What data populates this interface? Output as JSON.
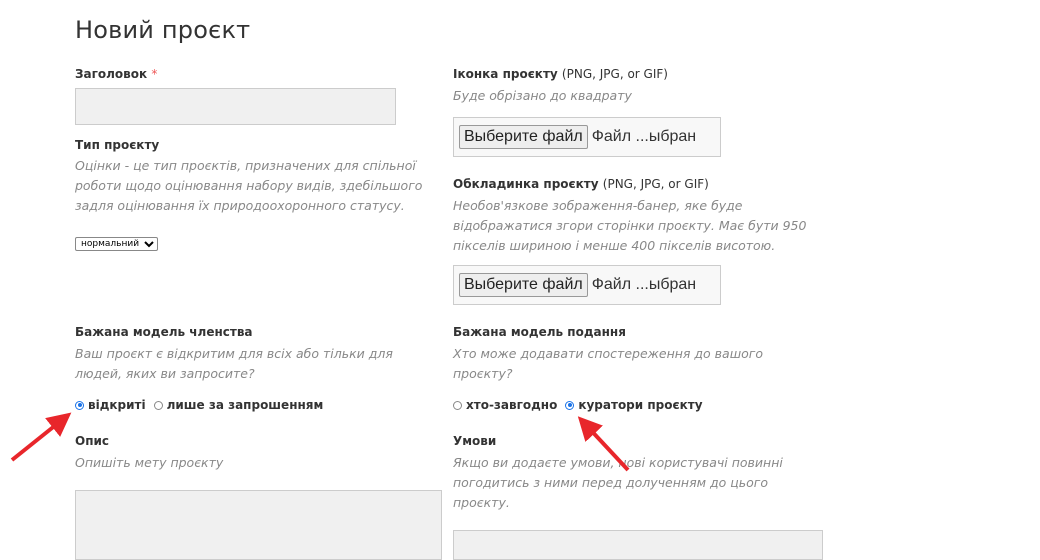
{
  "page": {
    "title": "Новий проєкт"
  },
  "left": {
    "title_label": "Заголовок",
    "required_mark": "*",
    "type_label": "Тип проєкту",
    "type_hint": [
      "Оцінки - це тип проєктів, призначених для спільної",
      "роботи щодо оцінювання набору видів, здебільшого",
      "задля оцінювання їх природоохоронного статусу."
    ],
    "type_select": "нормальний",
    "membership_label": "Бажана модель членства",
    "membership_hint": [
      "Ваш проєкт є відкритим для всіх або тільки для",
      "людей, яких ви запросите?"
    ],
    "membership_options": [
      "відкриті",
      "лише за запрошенням"
    ],
    "desc_label": "Опис",
    "desc_hint": "Опишіть мету проєкту"
  },
  "right": {
    "icon_label": "Іконка проєкту",
    "icon_formats": "(PNG, JPG, or GIF)",
    "icon_hint": "Буде обрізано до квадрату",
    "file_button": "Выберите файл",
    "file_status": "Файл ...ыбран",
    "cover_label": "Обкладинка проєкту",
    "cover_formats": "(PNG, JPG, or GIF)",
    "cover_hint": [
      "Необов'язкове зображення-банер, яке буде",
      "відображатися згори сторінки проєкту. Має бути 950",
      "пікселів шириною і менше 400 пікселів висотою."
    ],
    "submission_label": "Бажана модель подання",
    "submission_hint": [
      "Хто може додавати спостереження до вашого",
      "проєкту?"
    ],
    "submission_options": [
      "хто-завгодно",
      "куратори проєкту"
    ],
    "terms_label": "Умови",
    "terms_hint": [
      "Якщо ви додаєте умови, нові користувачі повинні",
      "погодитись з ними перед долученням до цього",
      "проєкту."
    ]
  },
  "colors": {
    "arrow": "#e8262b",
    "radio_accent": "#1a73e8"
  }
}
